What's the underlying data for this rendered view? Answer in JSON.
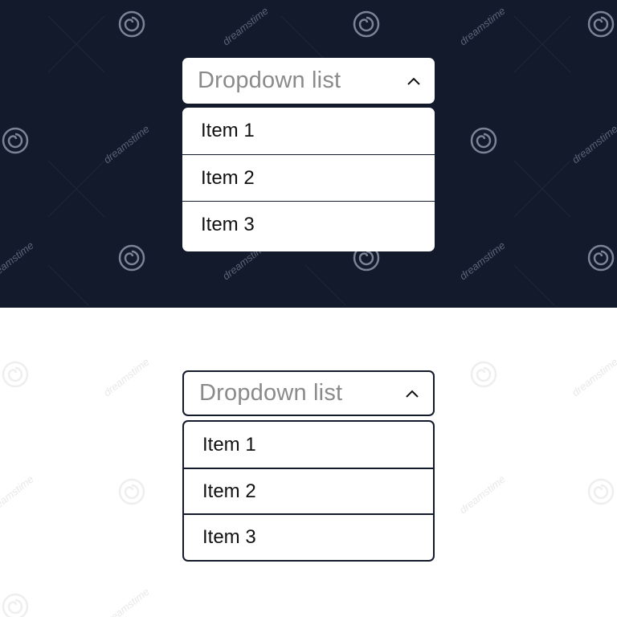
{
  "dark_variant": {
    "dropdown": {
      "label": "Dropdown list",
      "expanded": true,
      "items": [
        {
          "label": "Item 1"
        },
        {
          "label": "Item 2"
        },
        {
          "label": "Item 3"
        }
      ]
    }
  },
  "light_variant": {
    "dropdown": {
      "label": "Dropdown list",
      "expanded": true,
      "items": [
        {
          "label": "Item 1"
        },
        {
          "label": "Item 2"
        },
        {
          "label": "Item 3"
        }
      ]
    }
  },
  "watermark": {
    "text": "dreamstime"
  },
  "colors": {
    "dark_background": "#131a2b",
    "light_background": "#ffffff",
    "placeholder_text": "#8a8a8a",
    "item_text": "#111111",
    "border": "#131a2b"
  },
  "icons": {
    "chevron": "chevron-up-icon",
    "watermark_logo": "spiral-logo-icon"
  }
}
